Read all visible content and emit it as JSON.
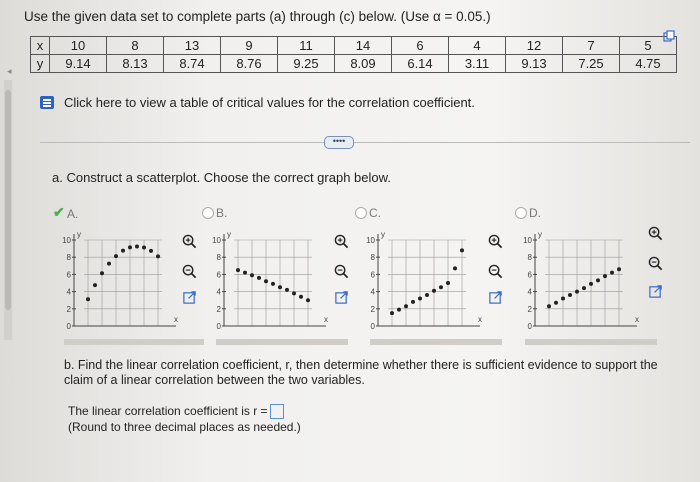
{
  "instructions": "Use the given data set to complete parts (a) through (c) below. (Use α = 0.05.)",
  "table": {
    "x_label": "x",
    "y_label": "y",
    "x": [
      "10",
      "8",
      "13",
      "9",
      "11",
      "14",
      "6",
      "4",
      "12",
      "7",
      "5"
    ],
    "y": [
      "9.14",
      "8.13",
      "8.74",
      "8.76",
      "9.25",
      "8.09",
      "6.14",
      "3.11",
      "9.13",
      "7.25",
      "4.75"
    ]
  },
  "critical_link": "Click here to view a table of critical values for the correlation coefficient.",
  "more_label": "••••",
  "part_a": "a. Construct a scatterplot. Choose the correct graph below.",
  "options": [
    {
      "label": "A.",
      "selected": true
    },
    {
      "label": "B.",
      "selected": false
    },
    {
      "label": "C.",
      "selected": false
    },
    {
      "label": "D.",
      "selected": false
    }
  ],
  "chart_data": [
    {
      "type": "scatter",
      "option": "A",
      "yticks": [
        "10",
        "8",
        "6",
        "4",
        "2",
        "0"
      ],
      "xlabel": "x",
      "ylabel": "y",
      "ylim": [
        0,
        10
      ],
      "x": [
        4,
        5,
        6,
        7,
        8,
        9,
        10,
        11,
        12,
        13,
        14
      ],
      "y": [
        3.11,
        4.75,
        6.14,
        7.25,
        8.13,
        8.76,
        9.14,
        9.25,
        9.13,
        8.74,
        8.09
      ]
    },
    {
      "type": "scatter",
      "option": "B",
      "yticks": [
        "10",
        "8",
        "6",
        "4",
        "2",
        "0"
      ],
      "xlabel": "x",
      "ylabel": "y",
      "ylim": [
        0,
        10
      ],
      "x": [
        4,
        5,
        6,
        7,
        8,
        9,
        10,
        11,
        12,
        13,
        14
      ],
      "y": [
        6.5,
        6.2,
        5.9,
        5.6,
        5.2,
        4.9,
        4.5,
        4.2,
        3.8,
        3.4,
        3.0
      ]
    },
    {
      "type": "scatter",
      "option": "C",
      "yticks": [
        "10",
        "8",
        "6",
        "4",
        "2",
        "0"
      ],
      "xlabel": "x",
      "ylabel": "y",
      "ylim": [
        0,
        10
      ],
      "x": [
        4,
        5,
        6,
        7,
        8,
        9,
        10,
        11,
        12,
        13,
        14
      ],
      "y": [
        1.5,
        1.9,
        2.3,
        2.8,
        3.2,
        3.6,
        4.1,
        4.5,
        5.0,
        6.7,
        8.8
      ]
    },
    {
      "type": "scatter",
      "option": "D",
      "yticks": [
        "10",
        "8",
        "6",
        "4",
        "2",
        "0"
      ],
      "xlabel": "x",
      "ylabel": "y",
      "ylim": [
        0,
        10
      ],
      "x": [
        4,
        5,
        6,
        7,
        8,
        9,
        10,
        11,
        12,
        13,
        14
      ],
      "y": [
        2.3,
        2.7,
        3.2,
        3.6,
        4.0,
        4.4,
        4.9,
        5.3,
        5.8,
        6.2,
        6.6
      ]
    }
  ],
  "part_b": "b. Find the linear correlation coefficient, r, then determine whether there is sufficient evidence to support the claim of a linear correlation between the two variables.",
  "coef_label": "The linear correlation coefficient is r =",
  "round_note": "(Round to three decimal places as needed.)"
}
